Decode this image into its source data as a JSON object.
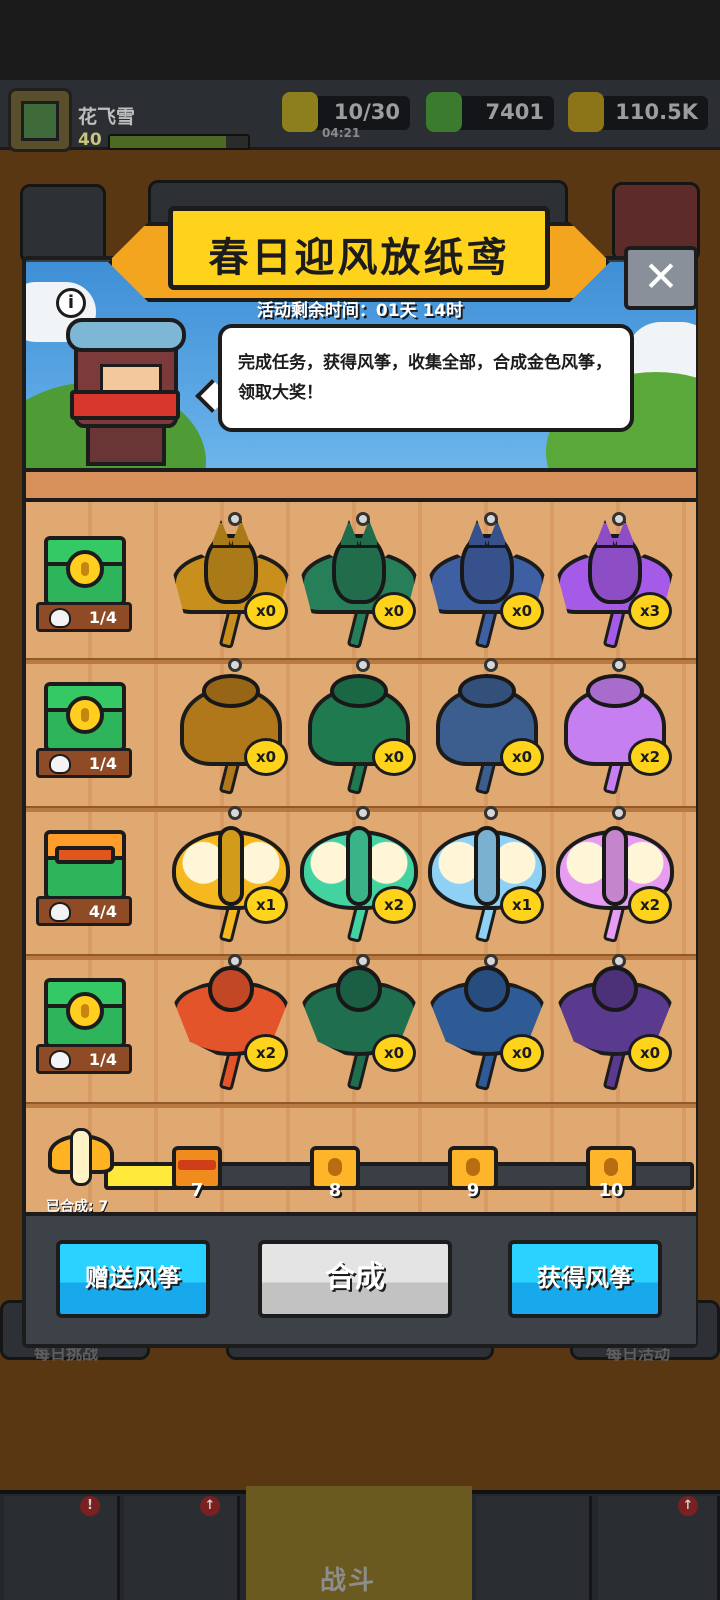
{
  "player": {
    "name": "花飞雪",
    "level": "40",
    "xp_fraction": 0.84
  },
  "resources": [
    {
      "name": "energy",
      "icon": "lightning-icon",
      "value": "10/30",
      "timer": "04:21"
    },
    {
      "name": "gems",
      "icon": "green-gem-icon",
      "value": "7401"
    },
    {
      "name": "coins",
      "icon": "gold-coin-icon",
      "value": "110.5K"
    }
  ],
  "event": {
    "title": "春日迎风放纸鸢",
    "timer_text": "活动剩余时间：01天 14时",
    "description": "完成任务，获得风筝，收集全部，合成金色风筝，领取大奖！"
  },
  "rows": [
    {
      "kite_type": "bat",
      "chest": {
        "count": "1/4",
        "opened": false
      },
      "kites": [
        {
          "color": "#c98f1c",
          "count": "x0"
        },
        {
          "color": "#267f58",
          "count": "x0"
        },
        {
          "color": "#3f5fa3",
          "count": "x0"
        },
        {
          "color": "#a65be8",
          "count": "x3"
        }
      ]
    },
    {
      "kite_type": "beetle",
      "chest": {
        "count": "1/4",
        "opened": false
      },
      "kites": [
        {
          "color": "#b0781a",
          "count": "x0"
        },
        {
          "color": "#1f7a4f",
          "count": "x0"
        },
        {
          "color": "#3c5e8f",
          "count": "x0"
        },
        {
          "color": "#c67ff0",
          "count": "x2"
        }
      ]
    },
    {
      "kite_type": "butterfly",
      "chest": {
        "count": "4/4",
        "opened": true
      },
      "kites": [
        {
          "color": "#f5b81f",
          "count": "x1"
        },
        {
          "color": "#43d3a0",
          "count": "x2"
        },
        {
          "color": "#8fd0f5",
          "count": "x1"
        },
        {
          "color": "#e69cf0",
          "count": "x2"
        }
      ]
    },
    {
      "kite_type": "bird",
      "chest": {
        "count": "1/4",
        "opened": false
      },
      "kites": [
        {
          "color": "#e3542b",
          "count": "x2"
        },
        {
          "color": "#1f6f4f",
          "count": "x0"
        },
        {
          "color": "#2e5b95",
          "count": "x0"
        },
        {
          "color": "#5a3a8e",
          "count": "x0"
        }
      ]
    }
  ],
  "progress": {
    "composed_label": "已合成: 7",
    "value": 7,
    "milestones": [
      {
        "label": "7",
        "reached": true
      },
      {
        "label": "8",
        "reached": false
      },
      {
        "label": "9",
        "reached": false
      },
      {
        "label": "10",
        "reached": false
      }
    ]
  },
  "buttons": {
    "gift": "赠送风筝",
    "compose": "合成",
    "obtain": "获得风筝"
  },
  "background_labels": {
    "left": "每日挑战",
    "right": "每日活动",
    "battle": "战斗"
  },
  "nav_badges": [
    "!",
    "↑",
    "↑"
  ],
  "colors": {
    "gold": "#ffd21c",
    "blue_button": "#18a8ec",
    "progress_fill": "#ffea3b"
  }
}
